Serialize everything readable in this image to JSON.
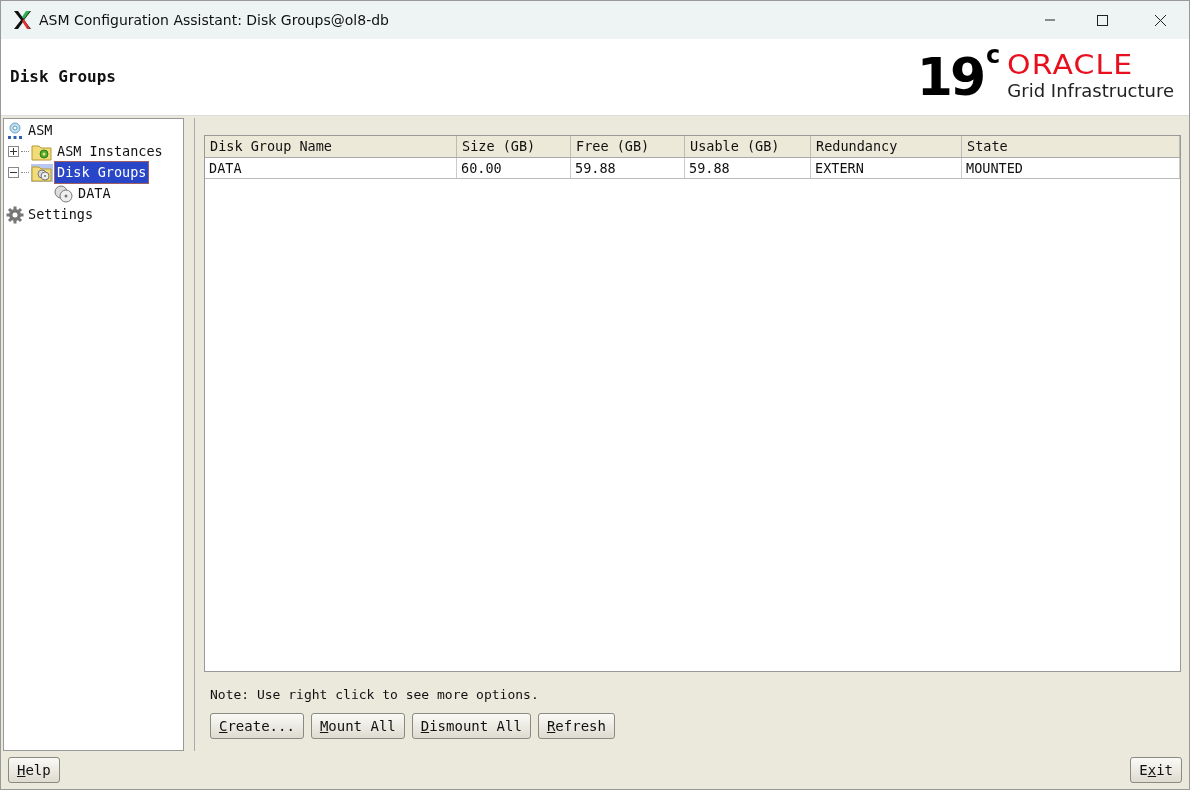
{
  "window": {
    "title": "ASM Configuration Assistant: Disk Groups@ol8-db"
  },
  "header": {
    "title": "Disk Groups",
    "logo": {
      "version": "19",
      "version_sup": "c",
      "brand": "ORACLE",
      "product": "Grid Infrastructure"
    }
  },
  "tree": [
    {
      "label": "ASM",
      "kind": "asm",
      "selected": false,
      "children": [
        {
          "label": "ASM Instances",
          "kind": "instances",
          "selected": false,
          "expanded": false
        },
        {
          "label": "Disk Groups",
          "kind": "groups",
          "selected": true,
          "expanded": true,
          "children": [
            {
              "label": "DATA",
              "kind": "disk",
              "selected": false
            }
          ]
        }
      ]
    },
    {
      "label": "Settings",
      "kind": "settings",
      "selected": false
    }
  ],
  "table": {
    "columns": [
      "Disk Group Name",
      "Size (GB)",
      "Free (GB)",
      "Usable (GB)",
      "Redundancy",
      "State"
    ],
    "rows": [
      [
        "DATA",
        "60.00",
        "59.88",
        "59.88",
        "EXTERN",
        "MOUNTED"
      ]
    ]
  },
  "note": "Note: Use right click to see more options.",
  "buttons": [
    {
      "key": "C",
      "after": "reate..."
    },
    {
      "key": "M",
      "after": "ount All"
    },
    {
      "key": "D",
      "after": "ismount All"
    },
    {
      "key": "R",
      "after": "efresh"
    }
  ],
  "footer_buttons": [
    {
      "key": "H",
      "after": "elp"
    },
    {
      "before": "E",
      "key": "x",
      "after": "it"
    }
  ]
}
